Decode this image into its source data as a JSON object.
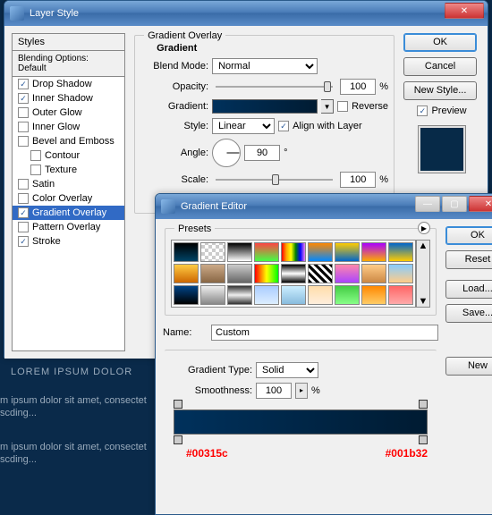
{
  "bg": {
    "title": "LOREM IPSUM DOLOR",
    "line": "m ipsum dolor sit amet, consectet",
    "line2": "scding..."
  },
  "layerStyle": {
    "title": "Layer Style",
    "ok": "OK",
    "cancel": "Cancel",
    "newStyle": "New Style...",
    "previewLabel": "Preview",
    "stylesHeader": "Styles",
    "blendingHeader": "Blending Options: Default",
    "items": [
      {
        "label": "Drop Shadow",
        "checked": true
      },
      {
        "label": "Inner Shadow",
        "checked": true
      },
      {
        "label": "Outer Glow",
        "checked": false
      },
      {
        "label": "Inner Glow",
        "checked": false
      },
      {
        "label": "Bevel and Emboss",
        "checked": false
      },
      {
        "label": "Contour",
        "checked": false,
        "sub": true
      },
      {
        "label": "Texture",
        "checked": false,
        "sub": true
      },
      {
        "label": "Satin",
        "checked": false
      },
      {
        "label": "Color Overlay",
        "checked": false
      },
      {
        "label": "Gradient Overlay",
        "checked": true,
        "selected": true
      },
      {
        "label": "Pattern Overlay",
        "checked": false
      },
      {
        "label": "Stroke",
        "checked": true
      }
    ],
    "panel": {
      "title": "Gradient Overlay",
      "subtitle": "Gradient",
      "blendMode": "Blend Mode:",
      "blendModeValue": "Normal",
      "opacity": "Opacity:",
      "opacityValue": "100",
      "pct": "%",
      "gradient": "Gradient:",
      "reverse": "Reverse",
      "style": "Style:",
      "styleValue": "Linear",
      "align": "Align with Layer",
      "angle": "Angle:",
      "angleValue": "90",
      "deg": "°",
      "scale": "Scale:",
      "scaleValue": "100"
    }
  },
  "gradEditor": {
    "title": "Gradient Editor",
    "ok": "OK",
    "reset": "Reset",
    "load": "Load...",
    "save": "Save...",
    "presets": "Presets",
    "name": "Name:",
    "nameValue": "Custom",
    "new": "New",
    "gradType": "Gradient Type:",
    "gradTypeValue": "Solid",
    "smoothness": "Smoothness:",
    "smoothnessValue": "100",
    "pct": "%",
    "color1": "#00315c",
    "color2": "#001b32",
    "swatches": [
      "linear-gradient(#000,#046)",
      "repeating-conic-gradient(#ccc 0 25%,#fff 0 50%) 0/8px 8px",
      "linear-gradient(#000,#fff)",
      "linear-gradient(#f44,#4f4)",
      "linear-gradient(90deg,red,orange,yellow,green,blue,violet)",
      "linear-gradient(#f80,#08f)",
      "linear-gradient(#fc0,#06c)",
      "linear-gradient(#a0f,#fa0)",
      "linear-gradient(#06c,#fc0)",
      "linear-gradient(#fc4,#c60)",
      "linear-gradient(#ca8,#864)",
      "linear-gradient(#ccc,#666)",
      "linear-gradient(90deg,red,yellow,lime)",
      "linear-gradient(#000,#fff,#000)",
      "repeating-linear-gradient(45deg,#000 0 3px,#fff 3px 6px)",
      "linear-gradient(#f8a,#a4f)",
      "linear-gradient(#fc8,#c84)",
      "linear-gradient(#8cf,#fc8)",
      "linear-gradient(#048,#000)",
      "linear-gradient(#eee,#888)",
      "linear-gradient(#333,#eee,#333)",
      "linear-gradient(#acf,#def)",
      "linear-gradient(#cef,#8bd)",
      "linear-gradient(#fda,#fed)",
      "linear-gradient(#4c4,#8f8)",
      "linear-gradient(#f80,#fc6)",
      "linear-gradient(#f66,#faa)"
    ]
  }
}
